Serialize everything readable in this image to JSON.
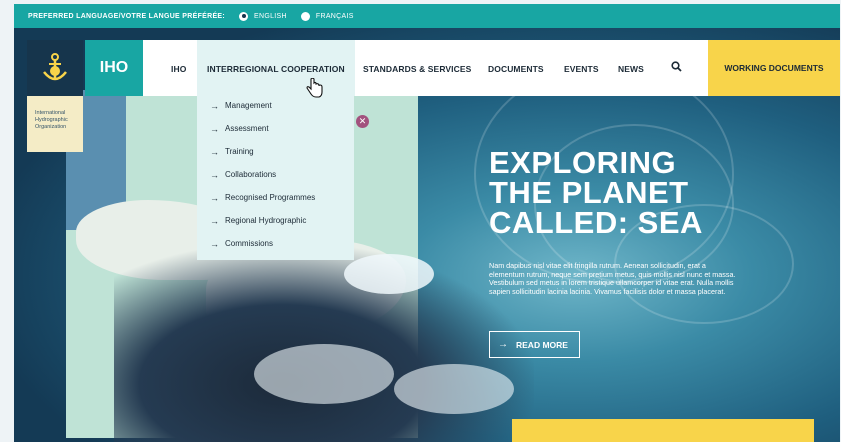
{
  "topbar": {
    "language_label": "PREFERRED LANGUAGE/VOTRE LANGUE PRÉFÉRÉE:",
    "options": [
      {
        "label": "ENGLISH",
        "selected": true
      },
      {
        "label": "FRANÇAIS",
        "selected": false
      }
    ]
  },
  "brand": {
    "short": "IHO",
    "org_line1": "International",
    "org_line2": "Hydrographic",
    "org_line3": "Organization"
  },
  "nav": {
    "items": [
      "IHO",
      "INTERREGIONAL COOPERATION",
      "STANDARDS & SERVICES",
      "DOCUMENTS",
      "EVENTS",
      "NEWS"
    ],
    "search_icon": "search-icon",
    "cta": "WORKING DOCUMENTS"
  },
  "dropdown": {
    "items": [
      "Management",
      "Assessment",
      "Training",
      "Collaborations",
      "Recognised Programmes",
      "Regional Hydrographic",
      "Commissions"
    ]
  },
  "hero": {
    "title_line1": "EXPLORING",
    "title_line2": "THE PLANET",
    "title_line3": "CALLED: SEA",
    "body": "Nam dapibus nisl vitae elit fringilla rutrum. Aenean sollicitudin, erat a elementum rutrum, neque sem pretium metus, quis mollis nisl nunc et massa. Vestibulum sed metus in lorem tristique ullamcorper id vitae erat. Nulla mollis sapien sollicitudin lacinia lacinia. Vivamus facilisis dolor et massa placerat.",
    "cta": "READ MORE"
  },
  "colors": {
    "teal": "#18a6a3",
    "navy": "#16354c",
    "yellow": "#f8d44a",
    "dropdown_bg": "#e2f3f3"
  }
}
